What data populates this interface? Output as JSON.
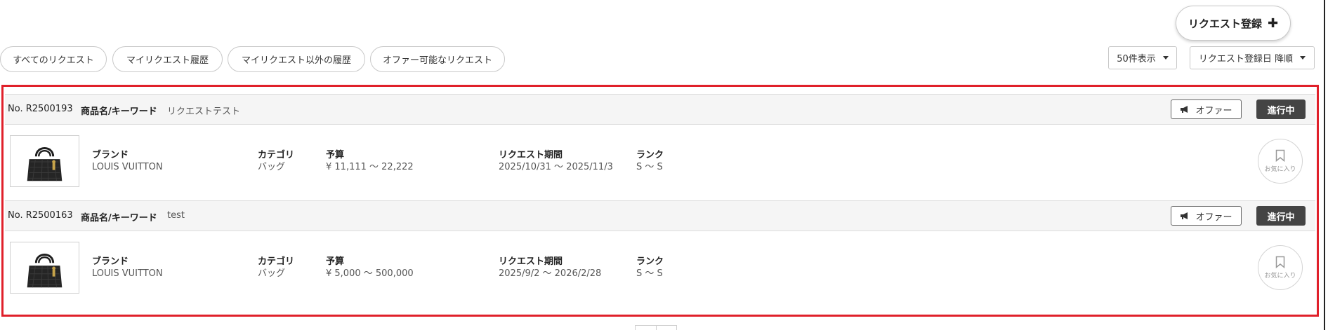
{
  "toolbar": {
    "register_label": "リクエスト登録",
    "register_icon": "plus-icon",
    "filters": [
      "すべてのリクエスト",
      "マイリクエスト履歴",
      "マイリクエスト以外の履歴",
      "オファー可能なリクエスト"
    ],
    "per_page": "50件表示",
    "sort": "リクエスト登録日 降順"
  },
  "colors": {
    "highlight": "#e0202a",
    "status_bg": "#444444"
  },
  "fields": {
    "keyword_label": "商品名/キーワード",
    "brand_label": "ブランド",
    "category_label": "カテゴリ",
    "budget_label": "予算",
    "period_label": "リクエスト期間",
    "rank_label": "ランク",
    "offer_label": "オファー",
    "favorite_label": "お気に入り"
  },
  "requests": [
    {
      "no": "No. R2500193",
      "keyword": "リクエストテスト",
      "status": "進行中",
      "brand": "LOUIS VUITTON",
      "category": "バッグ",
      "budget": "¥ 11,111 〜 22,222",
      "period": "2025/10/31 〜 2025/11/3",
      "rank": "S 〜 S"
    },
    {
      "no": "No. R2500163",
      "keyword": "test",
      "status": "進行中",
      "brand": "LOUIS VUITTON",
      "category": "バッグ",
      "budget": "¥ 5,000 〜 500,000",
      "period": "2025/9/2 〜 2026/2/28",
      "rank": "S 〜 S"
    }
  ]
}
